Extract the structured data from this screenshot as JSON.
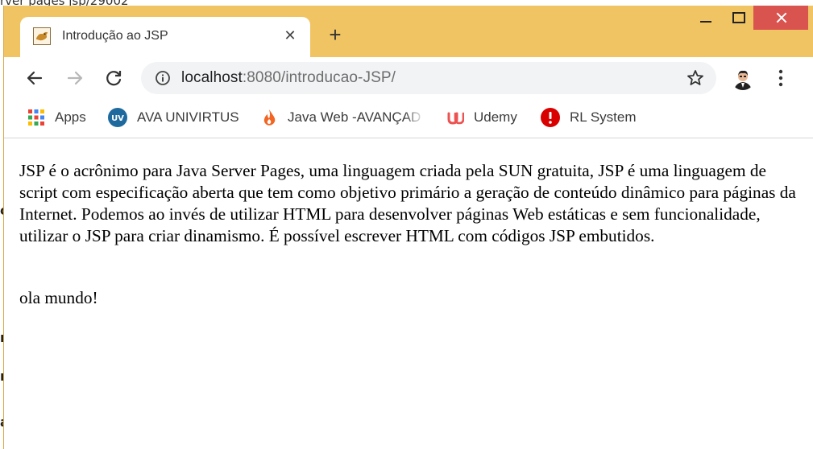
{
  "background": {
    "top_text": "rver pages jsp/29002"
  },
  "tab": {
    "title": "Introdução ao JSP",
    "close_label": "✕",
    "new_tab_label": "+"
  },
  "address_bar": {
    "host": "localhost",
    "rest": ":8080/introducao-JSP/"
  },
  "bookmarks": [
    {
      "label": "Apps",
      "icon": "apps-grid-icon"
    },
    {
      "label": "AVA UNIVIRTUS",
      "icon": "uv-icon"
    },
    {
      "label": "Java Web -AVANÇAD",
      "icon": "flame-icon"
    },
    {
      "label": "Udemy",
      "icon": "udemy-icon"
    },
    {
      "label": "RL System",
      "icon": "alert-circle-icon"
    }
  ],
  "content": {
    "paragraph": "JSP é o acrônimo para Java Server Pages, uma linguagem criada pela SUN gratuita, JSP é uma linguagem de script com especificação aberta que tem como objetivo primário a geração de conteúdo dinâmico para páginas da Internet. Podemos ao invés de utilizar HTML para desenvolver páginas Web estáticas e sem funcionalidade, utilizar o JSP para criar dinamismo. É possível escrever HTML com códigos JSP embutidos.",
    "output": "ola mundo!"
  },
  "colors": {
    "frame": "#f0c463",
    "close_button": "#d9534f",
    "omnibox": "#f1f3f4"
  }
}
